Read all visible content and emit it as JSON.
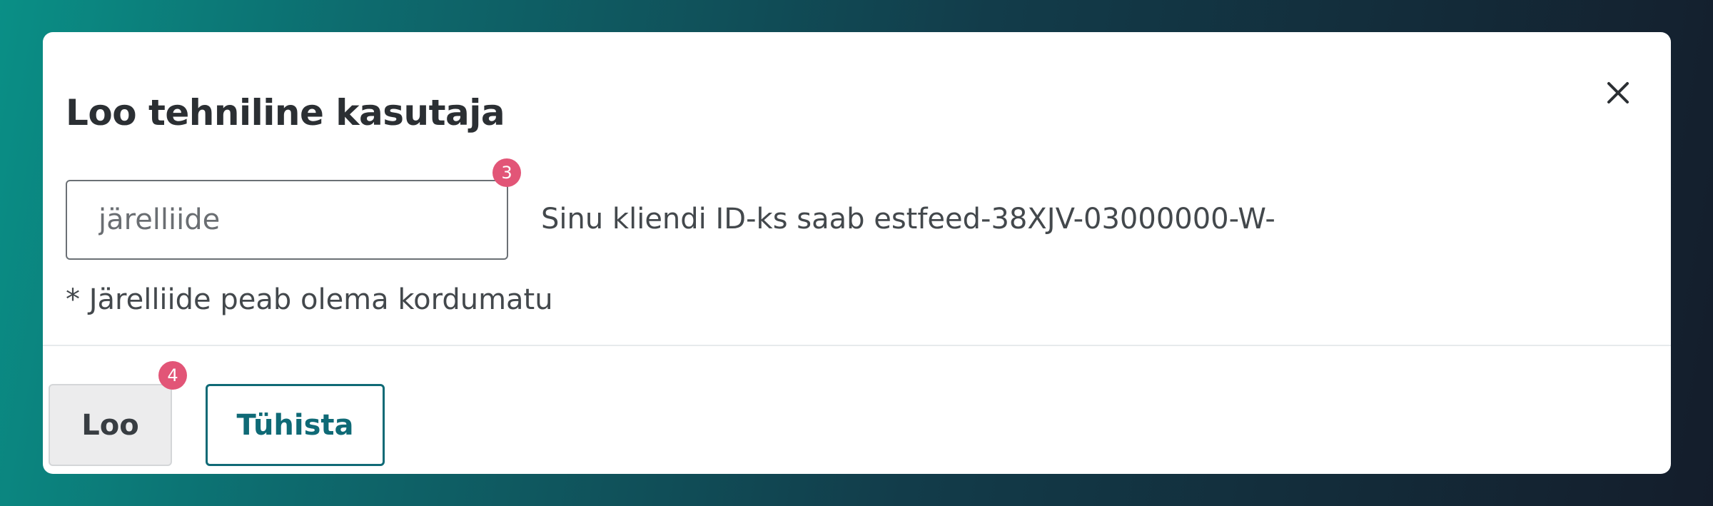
{
  "dialog": {
    "title": "Loo tehniline kasutaja",
    "close_icon": "close-icon"
  },
  "form": {
    "suffix_placeholder": "järelliide",
    "suffix_value": "",
    "id_hint": "Sinu kliendi ID-ks saab estfeed-38XJV-03000000-W-",
    "uniqueness_note": "* Järelliide peab olema kordumatu"
  },
  "badges": {
    "input_marker": "3",
    "create_marker": "4",
    "color": "#e25577"
  },
  "actions": {
    "create_label": "Loo",
    "cancel_label": "Tühista"
  },
  "colors": {
    "accent": "#0f6a76",
    "backdrop_start": "#0a8f86",
    "backdrop_end": "#141d2b"
  }
}
